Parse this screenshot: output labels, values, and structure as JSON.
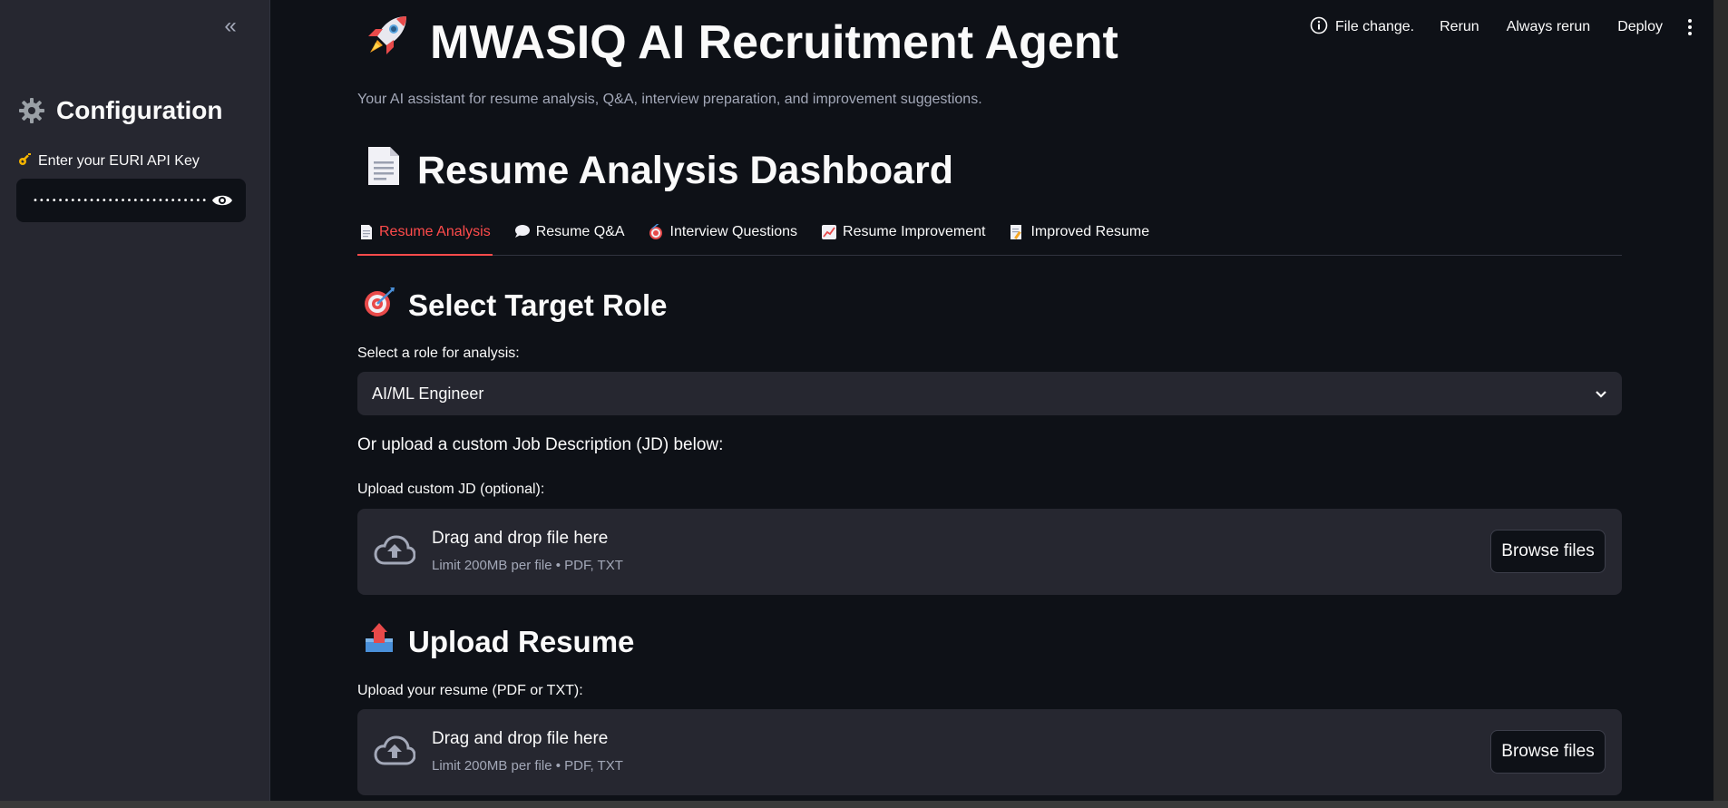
{
  "sidebar": {
    "collapse_glyph": "«",
    "config_title": "Configuration",
    "api_key_label": "Enter your EURI API Key",
    "api_key_value": "•••••••••••••••••••••••••••••••"
  },
  "toolbar": {
    "status": "File change.",
    "rerun": "Rerun",
    "always_rerun": "Always rerun",
    "deploy": "Deploy"
  },
  "header": {
    "title": "MWASIQ AI Recruitment Agent",
    "subtitle": "Your AI assistant for resume analysis, Q&A, interview preparation, and improvement suggestions.",
    "dashboard_title": "Resume Analysis Dashboard"
  },
  "tabs": [
    {
      "label": "Resume Analysis",
      "icon": "document-icon",
      "active": true
    },
    {
      "label": "Resume Q&A",
      "icon": "speech-bubble-icon",
      "active": false
    },
    {
      "label": "Interview Questions",
      "icon": "target-icon",
      "active": false
    },
    {
      "label": "Resume Improvement",
      "icon": "chart-up-icon",
      "active": false
    },
    {
      "label": "Improved Resume",
      "icon": "memo-icon",
      "active": false
    }
  ],
  "target_role": {
    "title": "Select Target Role",
    "select_label": "Select a role for analysis:",
    "selected": "AI/ML Engineer",
    "or_upload_text": "Or upload a custom Job Description (JD) below:",
    "upload_label": "Upload custom JD (optional):"
  },
  "jd_uploader": {
    "drop_title": "Drag and drop file here",
    "limit_text": "Limit 200MB per file • PDF, TXT",
    "browse_label": "Browse files"
  },
  "resume_upload": {
    "title": "Upload Resume",
    "upload_label": "Upload your resume (PDF or TXT):"
  },
  "resume_uploader": {
    "drop_title": "Drag and drop file here",
    "limit_text": "Limit 200MB per file • PDF, TXT",
    "browse_label": "Browse files"
  },
  "colors": {
    "background": "#0e1117",
    "sidebar": "#262730",
    "accent": "#ff4b4b",
    "muted_text": "#a3a8b8"
  }
}
